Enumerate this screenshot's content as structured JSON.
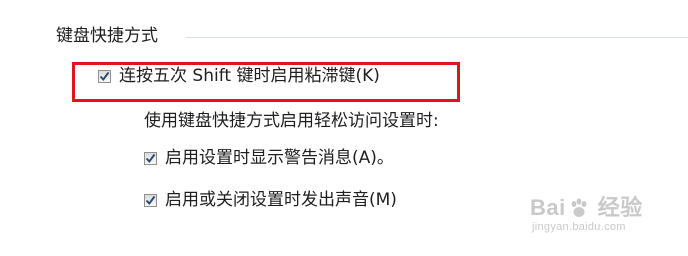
{
  "section": {
    "title": "键盘快捷方式"
  },
  "sticky_keys_option": {
    "label": "连按五次 Shift 键时启用粘滞键(K)",
    "checked": true
  },
  "shortcut_subtitle": "使用键盘快捷方式启用轻松访问设置时:",
  "warning_option": {
    "label": "启用设置时显示警告消息(A)。",
    "checked": true
  },
  "sound_option": {
    "label": "启用或关闭设置时发出声音(M)",
    "checked": true
  },
  "colors": {
    "highlight": "#e0151b",
    "check": "#2b4a6f"
  },
  "watermark": {
    "brand_left": "Bai",
    "brand_right": "经验",
    "url": "jingyan.baidu.com",
    "icon": "baidu-paw-icon"
  }
}
